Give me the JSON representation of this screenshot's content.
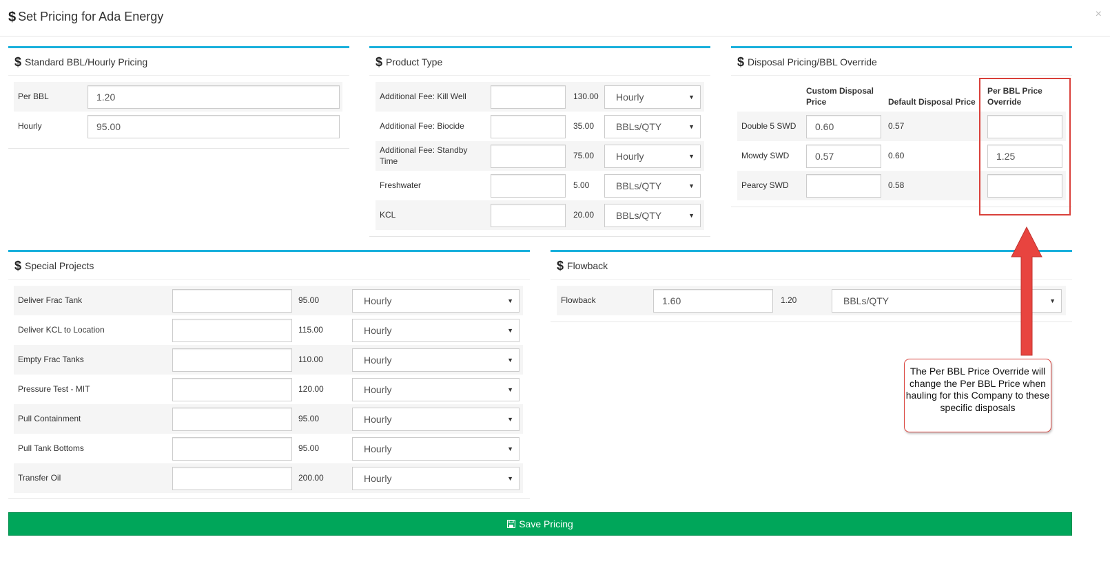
{
  "modal": {
    "title": "Set Pricing for Ada Energy",
    "close": "×"
  },
  "standard": {
    "title": "Standard BBL/Hourly Pricing",
    "rows": [
      {
        "label": "Per BBL",
        "value": "1.20"
      },
      {
        "label": "Hourly",
        "value": "95.00"
      }
    ]
  },
  "product": {
    "title": "Product Type",
    "rows": [
      {
        "label": "Additional Fee: Kill Well",
        "input": "",
        "default": "130.00",
        "unit": "Hourly"
      },
      {
        "label": "Additional Fee: Biocide",
        "input": "",
        "default": "35.00",
        "unit": "BBLs/QTY"
      },
      {
        "label": "Additional Fee: Standby Time",
        "input": "",
        "default": "75.00",
        "unit": "Hourly"
      },
      {
        "label": "Freshwater",
        "input": "",
        "default": "5.00",
        "unit": "BBLs/QTY"
      },
      {
        "label": "KCL",
        "input": "",
        "default": "20.00",
        "unit": "BBLs/QTY"
      }
    ]
  },
  "disposal": {
    "title": "Disposal Pricing/BBL Override",
    "headers": {
      "custom": "Custom Disposal Price",
      "default": "Default Disposal Price",
      "override": "Per BBL Price Override"
    },
    "rows": [
      {
        "label": "Double 5 SWD",
        "custom": "0.60",
        "default": "0.57",
        "override": ""
      },
      {
        "label": "Mowdy SWD",
        "custom": "0.57",
        "default": "0.60",
        "override": "1.25"
      },
      {
        "label": "Pearcy SWD",
        "custom": "",
        "default": "0.58",
        "override": ""
      }
    ]
  },
  "special": {
    "title": "Special Projects",
    "rows": [
      {
        "label": "Deliver Frac Tank",
        "input": "",
        "default": "95.00",
        "unit": "Hourly"
      },
      {
        "label": "Deliver KCL to Location",
        "input": "",
        "default": "115.00",
        "unit": "Hourly"
      },
      {
        "label": "Empty Frac Tanks",
        "input": "",
        "default": "110.00",
        "unit": "Hourly"
      },
      {
        "label": "Pressure Test - MIT",
        "input": "",
        "default": "120.00",
        "unit": "Hourly"
      },
      {
        "label": "Pull Containment",
        "input": "",
        "default": "95.00",
        "unit": "Hourly"
      },
      {
        "label": "Pull Tank Bottoms",
        "input": "",
        "default": "95.00",
        "unit": "Hourly"
      },
      {
        "label": "Transfer Oil",
        "input": "",
        "default": "200.00",
        "unit": "Hourly"
      }
    ]
  },
  "flowback": {
    "title": "Flowback",
    "row": {
      "label": "Flowback",
      "input": "1.60",
      "default": "1.20",
      "unit": "BBLs/QTY"
    }
  },
  "callout": {
    "text": "The Per BBL Price Override will change the Per BBL Price when hauling for this Company to these specific disposals"
  },
  "save": {
    "label": "Save Pricing"
  },
  "colors": {
    "accent": "#1ab0dc",
    "save": "#00a65a",
    "annotation": "#d9403a"
  }
}
